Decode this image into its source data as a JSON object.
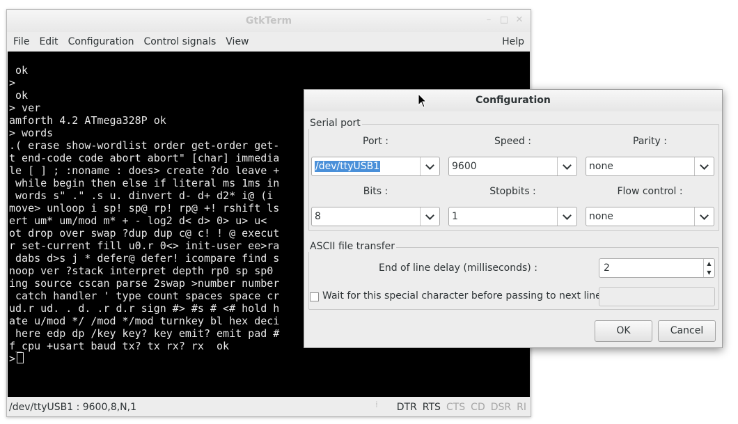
{
  "window": {
    "title": "GtkTerm",
    "controls": [
      "–",
      "□",
      "✕"
    ]
  },
  "menu": {
    "items": [
      "File",
      "Edit",
      "Configuration",
      "Control signals",
      "View"
    ],
    "help": "Help"
  },
  "terminal": {
    "lines": [
      " ok",
      ">",
      " ok",
      "> ver",
      "amforth 4.2 ATmega328P ok",
      "> words",
      ".( erase show-wordlist order get-order get-",
      "t end-code code abort abort\" [char] immedia",
      "le [ ] ; :noname : does> create ?do leave +",
      " while begin then else if literal ms 1ms in",
      " words s\" .\" .s u. dinvert d- d+ d2* i@ (i",
      "move> unloop i sp! sp@ rp! rp@ +! rshift ls",
      "ert um* um/mod m* + - log2 d< d> 0> u> u< ",
      "ot drop over swap ?dup dup c@ c! ! @ execut",
      "r set-current fill u0.r 0<> init-user ee>ra",
      " dabs d>s j * defer@ defer! icompare find s",
      "noop ver ?stack interpret depth rp0 sp sp0 ",
      "ing source cscan parse 2swap >number number",
      " catch handler ' type count spaces space cr",
      "ud.r ud. . d. .r d.r sign #> #s # <# hold h",
      "ate u/mod */ /mod */mod turnkey bl hex deci",
      " here edp dp /key key? key emit? emit pad #",
      "f_cpu +usart baud tx? tx rx? rx  ok"
    ],
    "prompt": ">"
  },
  "status": {
    "port_info": "/dev/ttyUSB1 : 9600,8,N,1",
    "signals": [
      {
        "label": "DTR",
        "active": true
      },
      {
        "label": "RTS",
        "active": true
      },
      {
        "label": "CTS",
        "active": false
      },
      {
        "label": "CD",
        "active": false
      },
      {
        "label": "DSR",
        "active": false
      },
      {
        "label": "RI",
        "active": false
      }
    ]
  },
  "dialog": {
    "title": "Configuration",
    "serial_port": {
      "frame_label": "Serial port",
      "port_label": "Port :",
      "port_value": "/dev/ttyUSB1",
      "speed_label": "Speed :",
      "speed_value": "9600",
      "parity_label": "Parity :",
      "parity_value": "none",
      "bits_label": "Bits :",
      "bits_value": "8",
      "stopbits_label": "Stopbits :",
      "stopbits_value": "1",
      "flow_label": "Flow control :",
      "flow_value": "none"
    },
    "ascii": {
      "frame_label": "ASCII file transfer",
      "eol_label": "End of line delay (milliseconds) :",
      "eol_value": "2",
      "wait_label": "Wait for this special character before passing to next line :",
      "wait_checked": false,
      "wait_value": ""
    },
    "ok_label": "OK",
    "cancel_label": "Cancel"
  },
  "colors": {
    "selection": "#4a90d9",
    "terminal_bg": "#000000",
    "terminal_fg": "#e8e8e8"
  }
}
